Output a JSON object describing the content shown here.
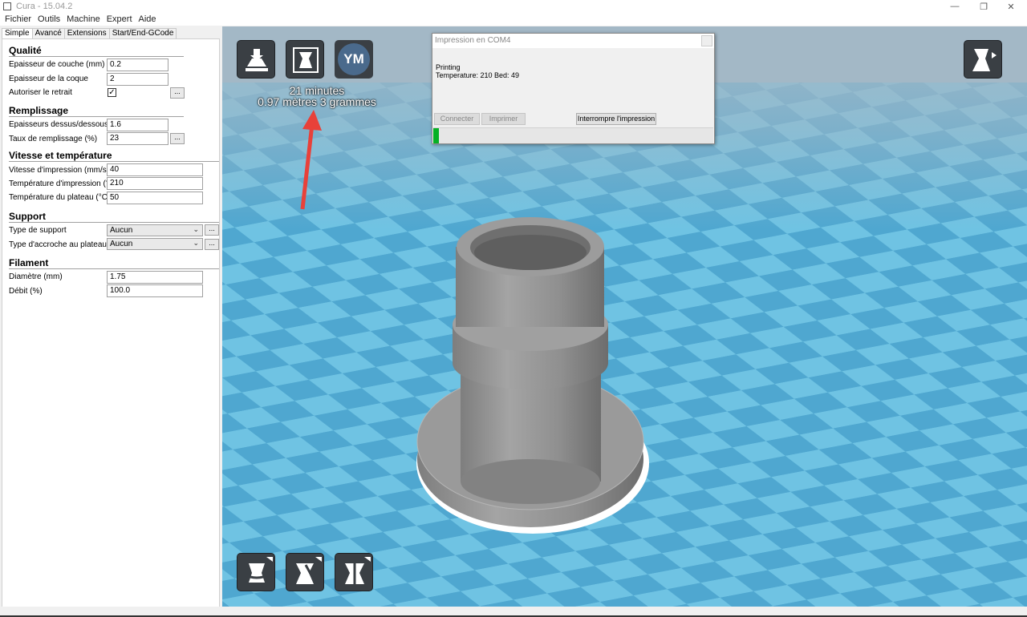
{
  "window": {
    "title": "Cura - 15.04.2",
    "controls": [
      "minimize-icon",
      "restore-icon",
      "close-icon"
    ]
  },
  "menu": [
    "Fichier",
    "Outils",
    "Machine",
    "Expert",
    "Aide"
  ],
  "tabs": [
    "Simple",
    "Avancé",
    "Extensions",
    "Start/End-GCode"
  ],
  "settings": {
    "qualite": {
      "heading": "Qualité",
      "layer_height": {
        "label": "Epaisseur de couche (mm)",
        "value": "0.2"
      },
      "shell_thickness": {
        "label": "Epaisseur de la coque",
        "value": "2"
      },
      "retraction": {
        "label": "Autoriser le retrait",
        "checked": "✓",
        "more": "..."
      }
    },
    "remplissage": {
      "heading": "Remplissage",
      "top_bottom": {
        "label": "Epaisseurs dessus/dessous (mm)",
        "value": "1.6"
      },
      "fill_density": {
        "label": "Taux de remplissage (%)",
        "value": "23",
        "more": "..."
      }
    },
    "vitesse": {
      "heading": "Vitesse et température",
      "print_speed": {
        "label": "Vitesse d'impression (mm/s)",
        "value": "40"
      },
      "print_temp": {
        "label": "Température d'impression (°C)",
        "value": "210"
      },
      "bed_temp": {
        "label": "Température du plateau (°C)",
        "value": "50"
      }
    },
    "support": {
      "heading": "Support",
      "support_type": {
        "label": "Type de support",
        "value": "Aucun",
        "more": "..."
      },
      "adhesion": {
        "label": "Type d'accroche au plateau",
        "value": "Aucun",
        "more": "..."
      }
    },
    "filament": {
      "heading": "Filament",
      "diameter": {
        "label": "Diamètre (mm)",
        "value": "1.75"
      },
      "flow": {
        "label": "Débit (%)",
        "value": "100.0"
      }
    }
  },
  "viewport": {
    "estimate_time": "21 minutes",
    "estimate_material": "0.97 mètres 3 grammes",
    "ym_badge": "YM",
    "colors": {
      "grid_light": "#6fc3e3",
      "grid_dark": "#4fa7d0",
      "model": "#8f8f8f",
      "annotation_arrow": "#e8413a"
    }
  },
  "print_dialog": {
    "title": "Impression en COM4",
    "status_line1": "Printing",
    "status_line2": "Temperature: 210 Bed: 49",
    "connect_label": "Connecter",
    "print_label": "Imprimer",
    "abort_label": "Interrompre l'impression",
    "progress": 0.02
  }
}
